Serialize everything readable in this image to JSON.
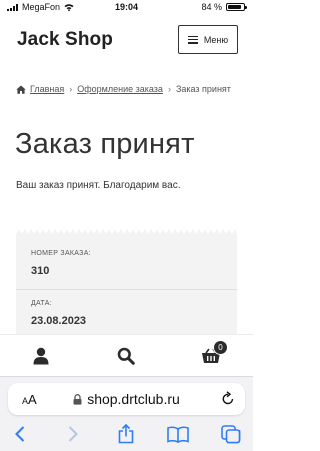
{
  "status_bar": {
    "carrier": "MegaFon",
    "time": "19:04",
    "battery_text": "84 %",
    "battery_level": 0.84
  },
  "header": {
    "brand": "Jack Shop",
    "menu_label": "Меню"
  },
  "breadcrumb": {
    "items": [
      "Главная",
      "Оформление заказа",
      "Заказ принят"
    ]
  },
  "page": {
    "title": "Заказ принят",
    "thanks": "Ваш заказ принят. Благодарим вас."
  },
  "order": {
    "number_label": "НОМЕР ЗАКАЗА:",
    "number_value": "310",
    "date_label": "ДАТА:",
    "date_value": "23.08.2023"
  },
  "bottom_bar": {
    "cart_count": "0",
    "icons": [
      "user-icon",
      "search-icon",
      "cart-icon"
    ]
  },
  "safari": {
    "text_size_label": "AA",
    "url": "shop.drtclub.ru",
    "toolbar_icons": [
      "back-icon",
      "forward-icon",
      "share-icon",
      "bookmarks-icon",
      "tabs-icon"
    ]
  },
  "colors": {
    "accent_ios": "#2f7cf6",
    "text": "#333333",
    "receipt_bg": "#f3f3f3"
  }
}
